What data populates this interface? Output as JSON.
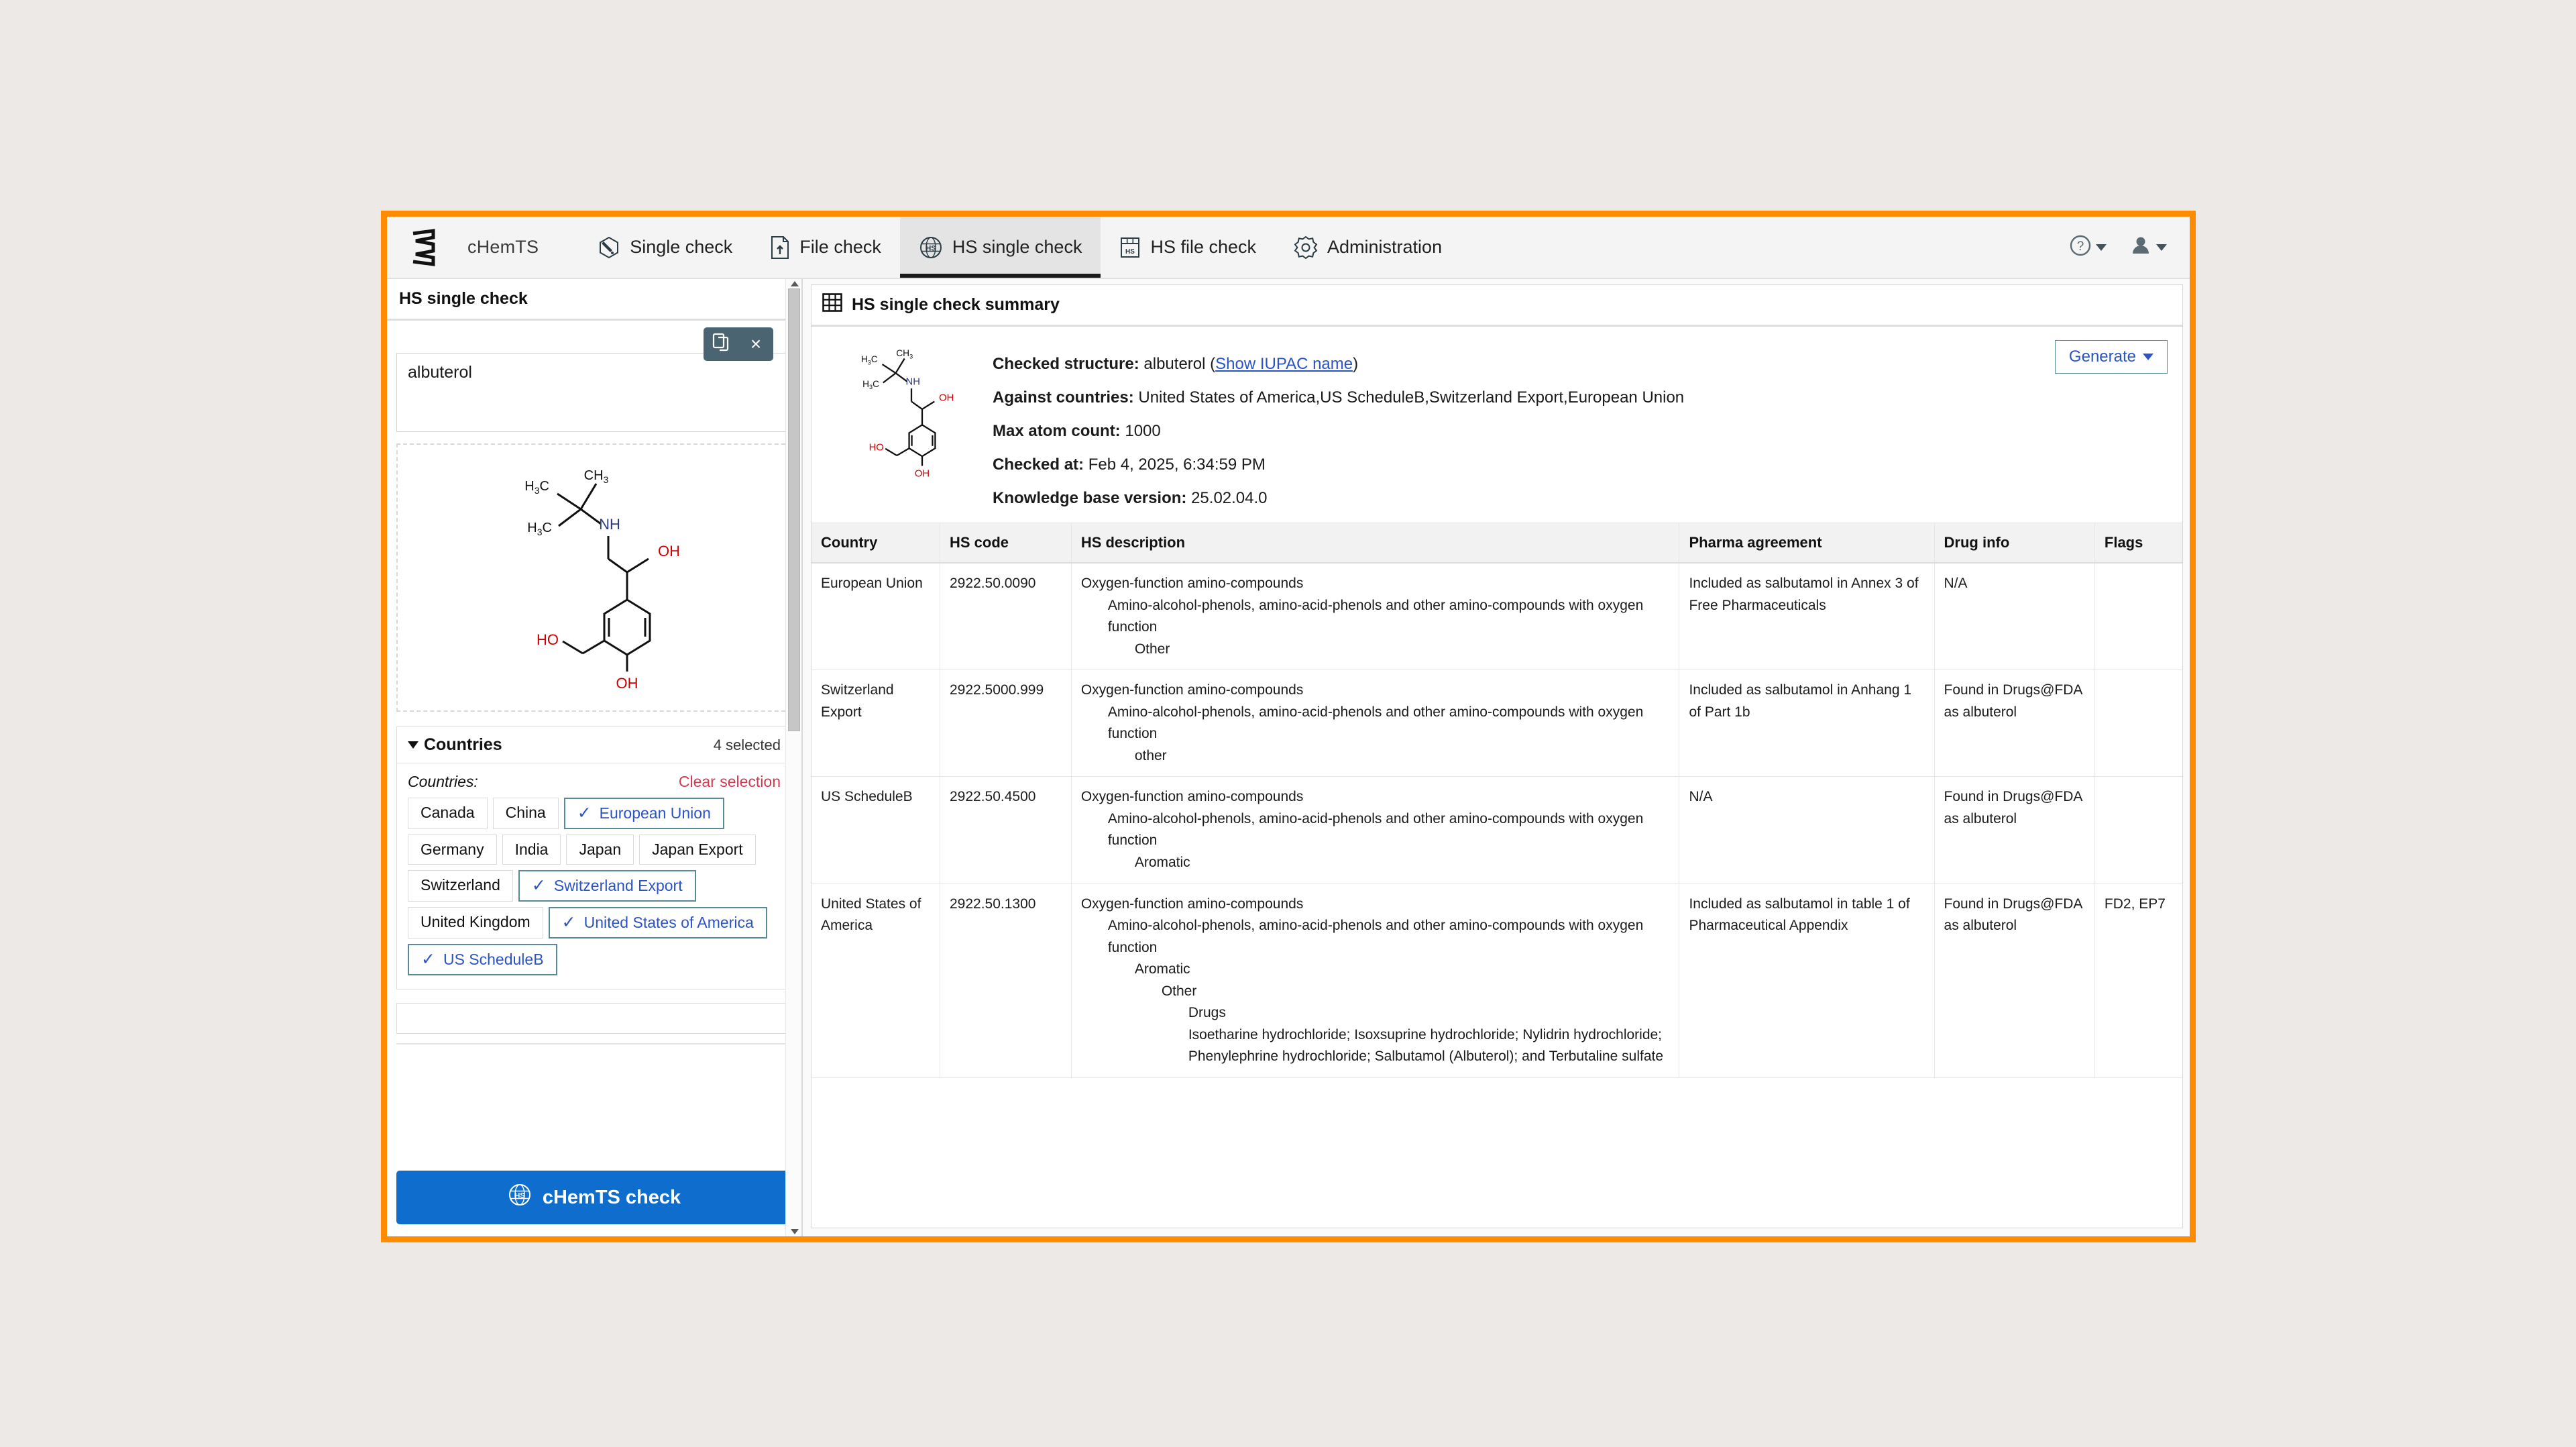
{
  "app": {
    "brand": "cHemTS",
    "logo_icon": "chemts-logo-icon"
  },
  "nav": {
    "tabs": [
      {
        "label": "Single check",
        "icon": "hexagon-pen-icon",
        "active": false
      },
      {
        "label": "File check",
        "icon": "file-upload-icon",
        "active": false
      },
      {
        "label": "HS single check",
        "icon": "hs-globe-icon",
        "active": true
      },
      {
        "label": "HS file check",
        "icon": "hs-table-icon",
        "active": false
      },
      {
        "label": "Administration",
        "icon": "gear-icon",
        "active": false
      }
    ],
    "help_icon": "question-circle-icon",
    "account_icon": "user-icon"
  },
  "left": {
    "title": "HS single check",
    "toolbar": {
      "copy_icon": "copy-icon",
      "copy_label": "",
      "close_icon": "close-icon",
      "close_label": "×"
    },
    "smiles_value": "albuterol",
    "smiles_placeholder": "",
    "structure_alt": "albuterol-structure",
    "countries": {
      "title": "Countries",
      "selected_count": "4 selected",
      "label": "Countries:",
      "clear_label": "Clear selection",
      "chips": [
        {
          "label": "Canada",
          "selected": false
        },
        {
          "label": "China",
          "selected": false
        },
        {
          "label": "European Union",
          "selected": true
        },
        {
          "label": "Germany",
          "selected": false
        },
        {
          "label": "India",
          "selected": false
        },
        {
          "label": "Japan",
          "selected": false
        },
        {
          "label": "Japan Export",
          "selected": false
        },
        {
          "label": "Switzerland",
          "selected": false
        },
        {
          "label": "Switzerland Export",
          "selected": true
        },
        {
          "label": "United Kingdom",
          "selected": false
        },
        {
          "label": "United States of America",
          "selected": true
        },
        {
          "label": "US ScheduleB",
          "selected": true
        }
      ]
    },
    "check_button": {
      "label": "cHemTS check",
      "icon": "hs-globe-icon"
    }
  },
  "right": {
    "title": "HS single check summary",
    "title_icon": "table-grid-icon",
    "generate_label": "Generate",
    "meta": {
      "checked_structure_label": "Checked structure:",
      "checked_structure_value": "albuterol",
      "iupac_link": "Show IUPAC name",
      "against_countries_label": "Against countries:",
      "against_countries_value": "United States of America,US ScheduleB,Switzerland Export,European Union",
      "max_atom_label": "Max atom count:",
      "max_atom_value": "1000",
      "checked_at_label": "Checked at:",
      "checked_at_value": "Feb 4, 2025, 6:34:59 PM",
      "kb_version_label": "Knowledge base version:",
      "kb_version_value": "25.02.04.0"
    },
    "table": {
      "columns": [
        "Country",
        "HS code",
        "HS description",
        "Pharma agreement",
        "Drug info",
        "Flags"
      ],
      "rows": [
        {
          "country": "European Union",
          "hs_code": "2922.50.0090",
          "desc": [
            {
              "indent": 0,
              "text": "Oxygen-function amino-compounds"
            },
            {
              "indent": 1,
              "text": "Amino-alcohol-phenols, amino-acid-phenols and other amino-compounds with oxygen function"
            },
            {
              "indent": 2,
              "text": "Other"
            }
          ],
          "pharma": "Included as salbutamol in Annex 3 of Free Pharmaceuticals",
          "drug_info": "N/A",
          "flags": ""
        },
        {
          "country": "Switzerland Export",
          "hs_code": "2922.5000.999",
          "desc": [
            {
              "indent": 0,
              "text": "Oxygen-function amino-compounds"
            },
            {
              "indent": 1,
              "text": "Amino-alcohol-phenols, amino-acid-phenols and other amino-compounds with oxygen function"
            },
            {
              "indent": 2,
              "text": "other"
            }
          ],
          "pharma": "Included as salbutamol in Anhang 1 of Part 1b",
          "drug_info": "Found in Drugs@FDA as albuterol",
          "flags": ""
        },
        {
          "country": "US ScheduleB",
          "hs_code": "2922.50.4500",
          "desc": [
            {
              "indent": 0,
              "text": "Oxygen-function amino-compounds"
            },
            {
              "indent": 1,
              "text": "Amino-alcohol-phenols, amino-acid-phenols and other amino-compounds with oxygen function"
            },
            {
              "indent": 2,
              "text": "Aromatic"
            }
          ],
          "pharma": "N/A",
          "drug_info": "Found in Drugs@FDA as albuterol",
          "flags": ""
        },
        {
          "country": "United States of America",
          "hs_code": "2922.50.1300",
          "desc": [
            {
              "indent": 0,
              "text": "Oxygen-function amino-compounds"
            },
            {
              "indent": 1,
              "text": "Amino-alcohol-phenols, amino-acid-phenols and other amino-compounds with oxygen function"
            },
            {
              "indent": 2,
              "text": "Aromatic"
            },
            {
              "indent": 3,
              "text": "Other"
            },
            {
              "indent": 4,
              "text": "Drugs"
            },
            {
              "indent": 4,
              "text": "Isoetharine hydrochloride; Isoxsuprine hydrochloride; Nylidrin hydrochloride; Phenylephrine hydrochloride; Salbutamol (Albuterol); and Terbutaline sulfate"
            }
          ],
          "pharma": "Included as salbutamol in table 1 of Pharmaceutical Appendix",
          "drug_info": "Found in Drugs@FDA as albuterol",
          "flags": "FD2, EP7"
        }
      ]
    }
  },
  "colors": {
    "accent_orange": "#ff8c00",
    "primary_blue": "#0f6ecd",
    "link_blue": "#2a53c4",
    "danger_red": "#d13a52",
    "toolbar_slate": "#4b6472"
  }
}
